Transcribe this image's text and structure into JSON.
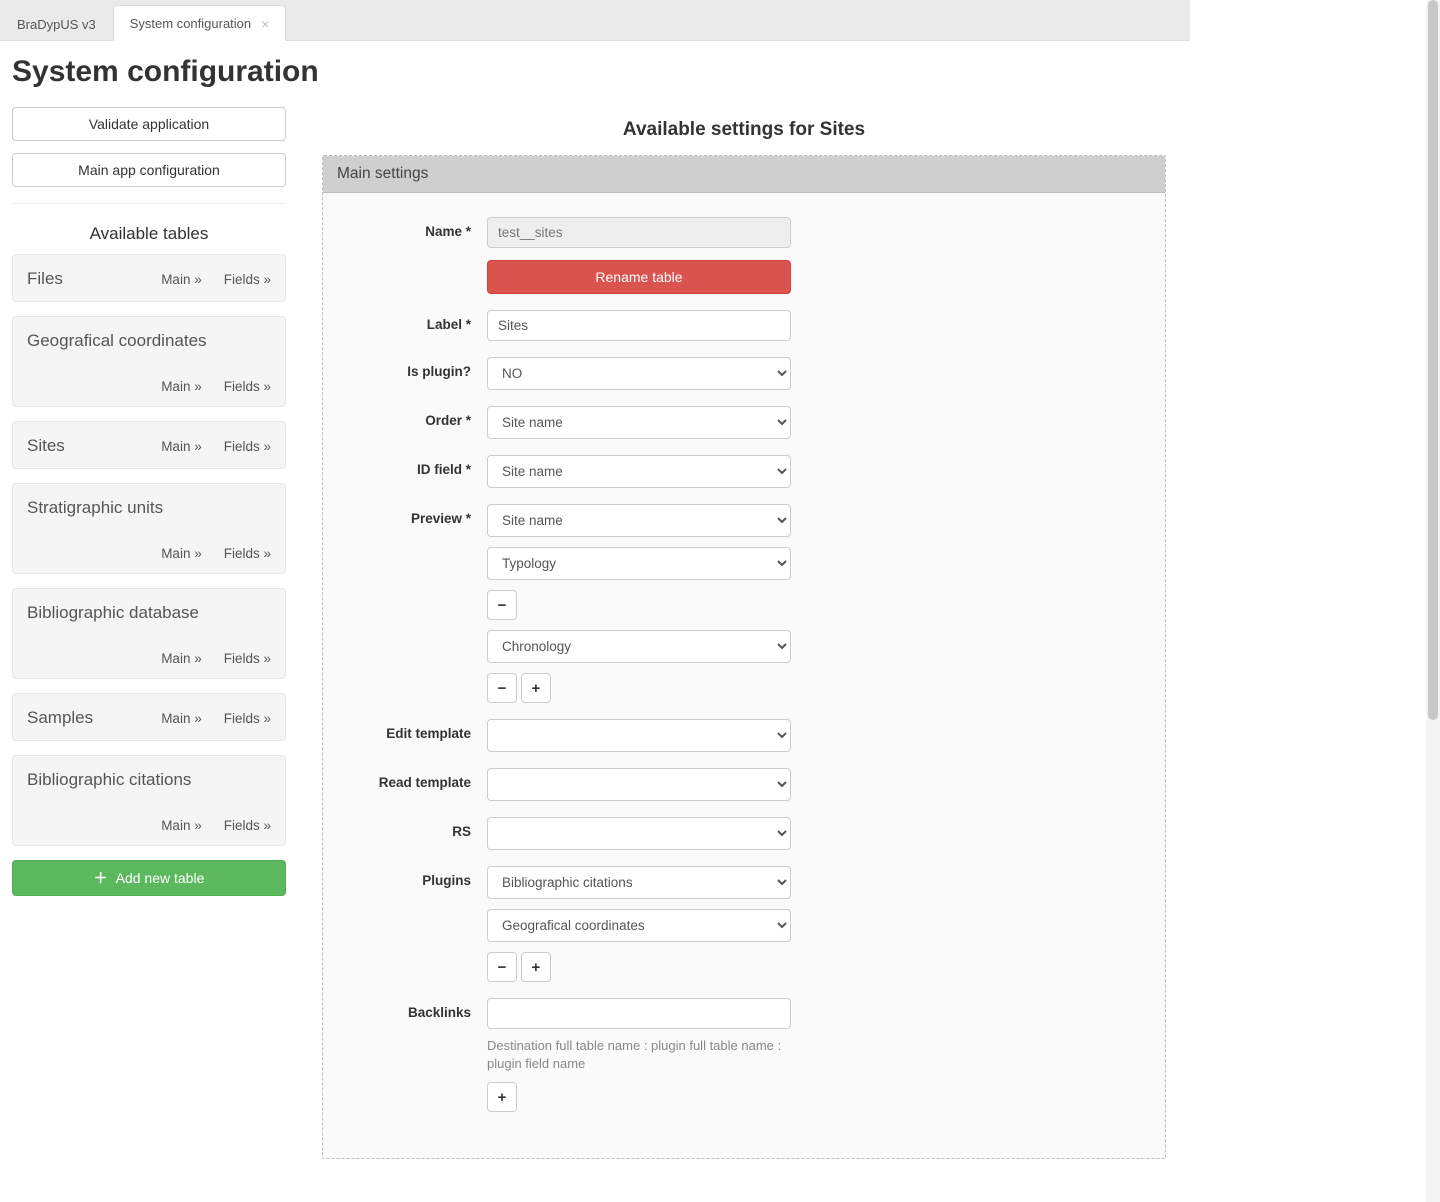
{
  "tabs": [
    {
      "label": "BraDypUS v3",
      "active": false
    },
    {
      "label": "System configuration",
      "active": true
    }
  ],
  "page_title": "System configuration",
  "sidebar": {
    "validate_btn": "Validate application",
    "main_cfg_btn": "Main app configuration",
    "tables_heading": "Available tables",
    "main_link": "Main »",
    "fields_link": "Fields »",
    "tables": [
      {
        "title": "Files",
        "compact": true
      },
      {
        "title": "Geografical coordinates",
        "compact": false
      },
      {
        "title": "Sites",
        "compact": true
      },
      {
        "title": "Stratigraphic units",
        "compact": false
      },
      {
        "title": "Bibliographic database",
        "compact": false
      },
      {
        "title": "Samples",
        "compact": true
      },
      {
        "title": "Bibliographic citations",
        "compact": false
      }
    ],
    "add_table_btn": "Add new table"
  },
  "main": {
    "heading": "Available settings for Sites",
    "panel_title": "Main settings",
    "labels": {
      "name": "Name *",
      "label": "Label *",
      "is_plugin": "Is plugin?",
      "order": "Order *",
      "id_field": "ID field *",
      "preview": "Preview *",
      "edit_tmpl": "Edit template",
      "read_tmpl": "Read template",
      "rs": "RS",
      "plugins": "Plugins",
      "backlinks": "Backlinks"
    },
    "values": {
      "name": "test__sites",
      "label": "Sites",
      "is_plugin": "NO",
      "order": "Site name",
      "id_field": "Site name",
      "preview1": "Site name",
      "preview2": "Typology",
      "preview3": "Chronology",
      "edit_tmpl": "",
      "read_tmpl": "",
      "rs": "",
      "plugin1": "Bibliographic citations",
      "plugin2": "Geografical coordinates",
      "backlinks": ""
    },
    "rename_btn": "Rename table",
    "backlinks_helper": "Destination full table name : plugin full table name : plugin field name",
    "minus": "−",
    "plus": "+"
  }
}
